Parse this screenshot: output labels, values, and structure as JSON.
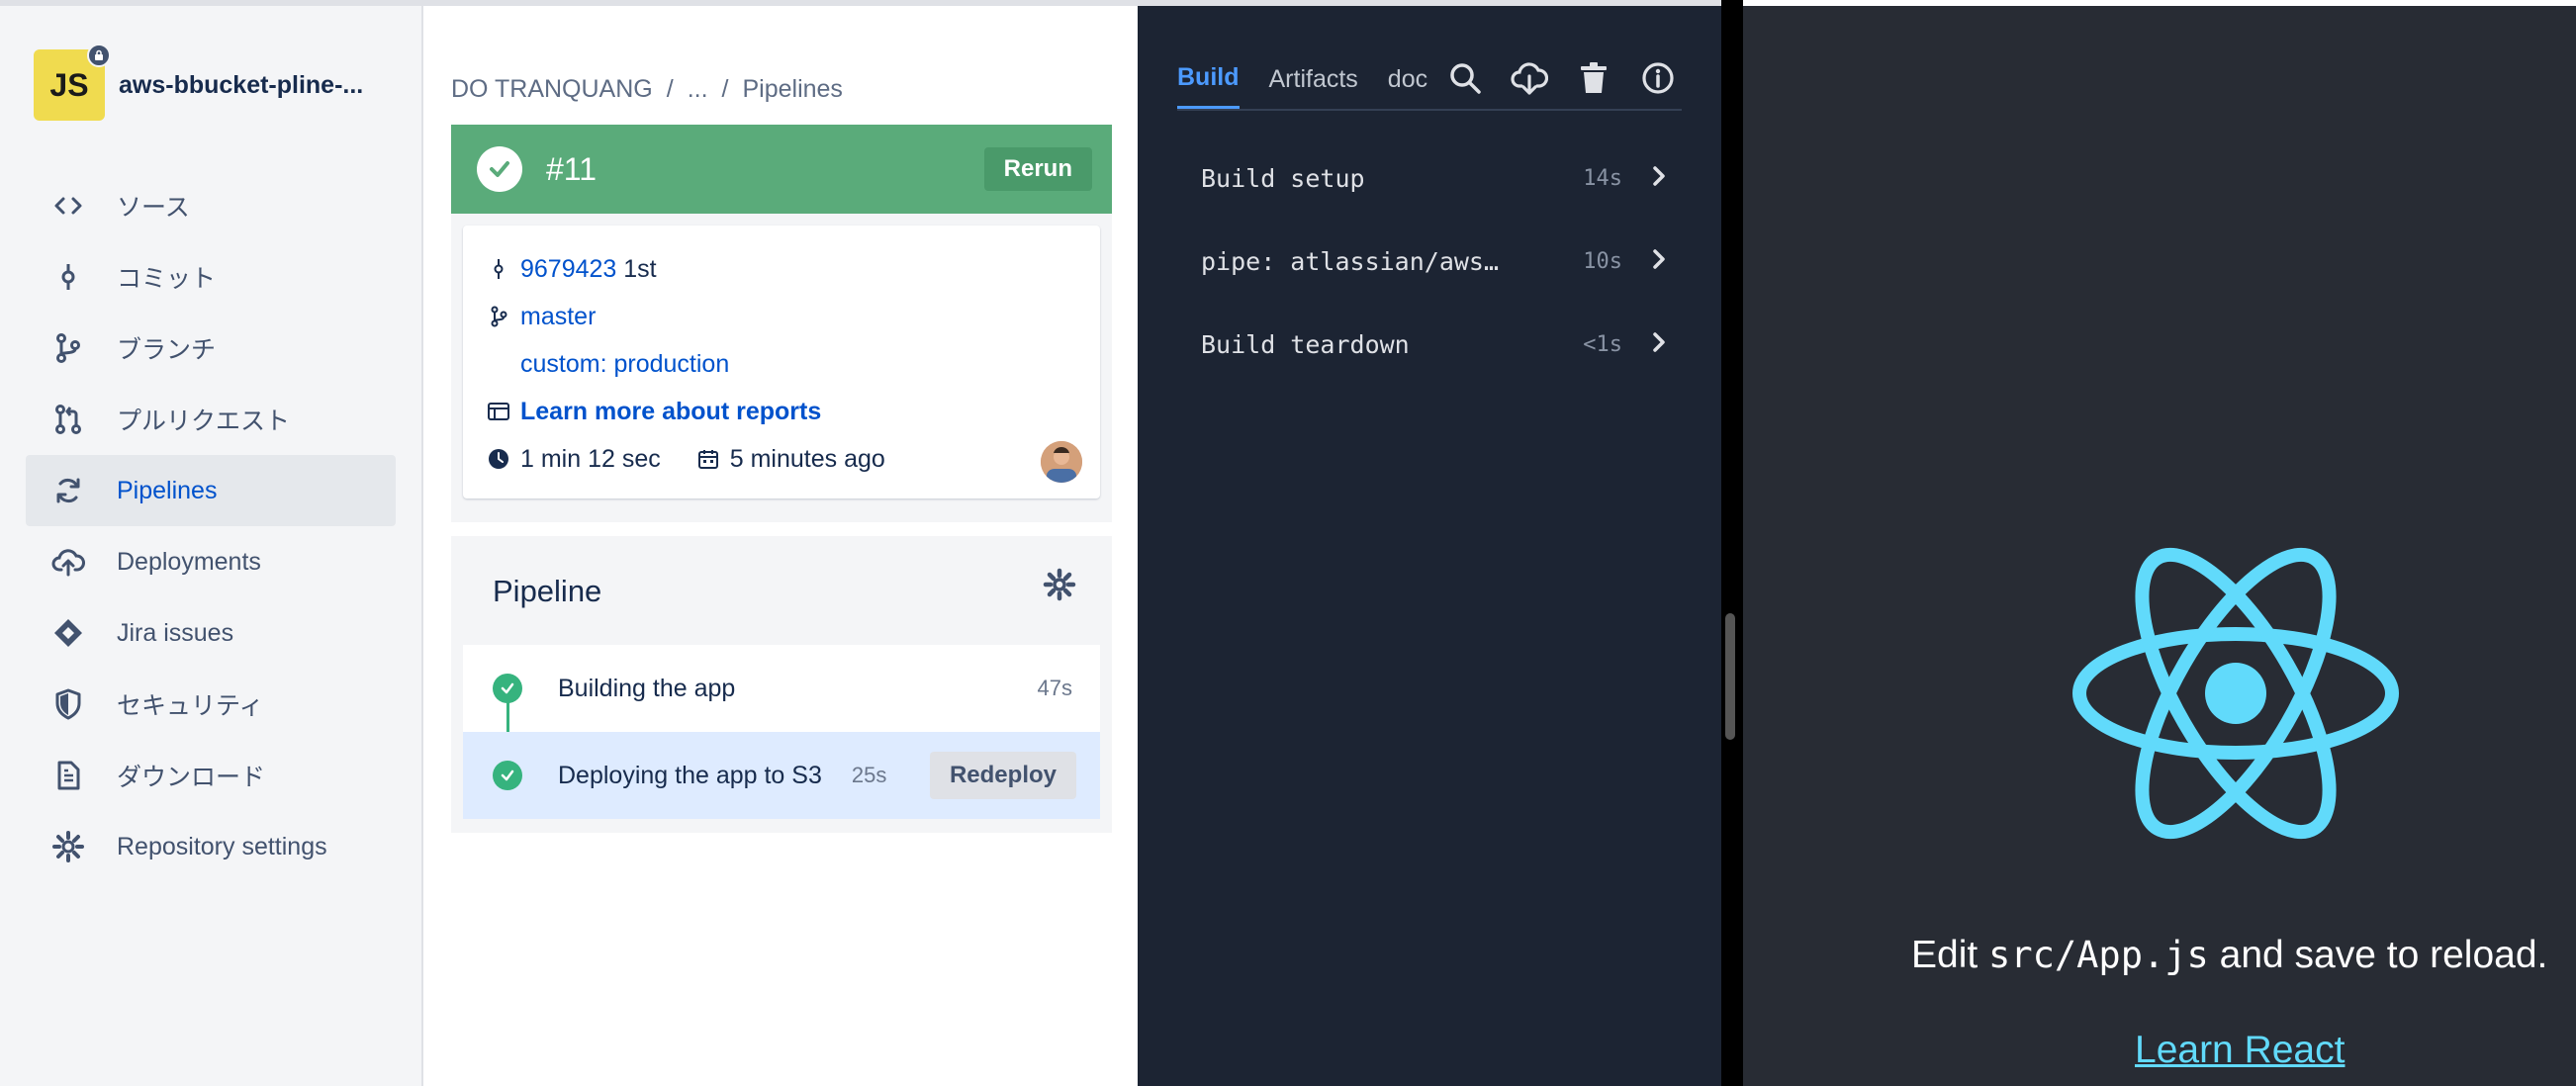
{
  "sidebar": {
    "repo_avatar_text": "JS",
    "repo_name": "aws-bbucket-pline-...",
    "items": [
      {
        "label": "ソース",
        "icon": "code-icon"
      },
      {
        "label": "コミット",
        "icon": "commit-icon"
      },
      {
        "label": "ブランチ",
        "icon": "branch-icon"
      },
      {
        "label": "プルリクエスト",
        "icon": "pull-request-icon"
      },
      {
        "label": "Pipelines",
        "icon": "pipelines-icon",
        "active": true
      },
      {
        "label": "Deployments",
        "icon": "deployments-icon"
      },
      {
        "label": "Jira issues",
        "icon": "jira-icon"
      },
      {
        "label": "セキュリティ",
        "icon": "shield-icon"
      },
      {
        "label": "ダウンロード",
        "icon": "download-file-icon"
      },
      {
        "label": "Repository settings",
        "icon": "gear-icon"
      }
    ]
  },
  "breadcrumb": {
    "owner": "DO TRANQUANG",
    "sep": "/",
    "ellipsis": "...",
    "current": "Pipelines"
  },
  "run": {
    "number": "#11",
    "rerun_label": "Rerun",
    "status_color": "#5aab7a",
    "commit_hash": "9679423",
    "commit_msg": "1st",
    "branch": "master",
    "trigger": "custom: production",
    "reports_link": "Learn more about reports",
    "duration": "1 min 12 sec",
    "started": "5 minutes ago"
  },
  "pipeline": {
    "title": "Pipeline",
    "steps": [
      {
        "name": "Building the app",
        "duration": "47s"
      },
      {
        "name": "Deploying the app to S3",
        "duration": "25s",
        "action": "Redeploy"
      }
    ]
  },
  "logs": {
    "tabs": [
      "Build",
      "Artifacts",
      "doc"
    ],
    "rows": [
      {
        "name": "Build setup",
        "time": "14s"
      },
      {
        "name": "pipe: atlassian/aws…",
        "time": "10s"
      },
      {
        "name": "Build teardown",
        "time": "<1s"
      }
    ]
  },
  "react_app": {
    "edit_prefix": "Edit ",
    "edit_code": "src/App.js",
    "edit_suffix": " and save to reload.",
    "link": "Learn React"
  }
}
